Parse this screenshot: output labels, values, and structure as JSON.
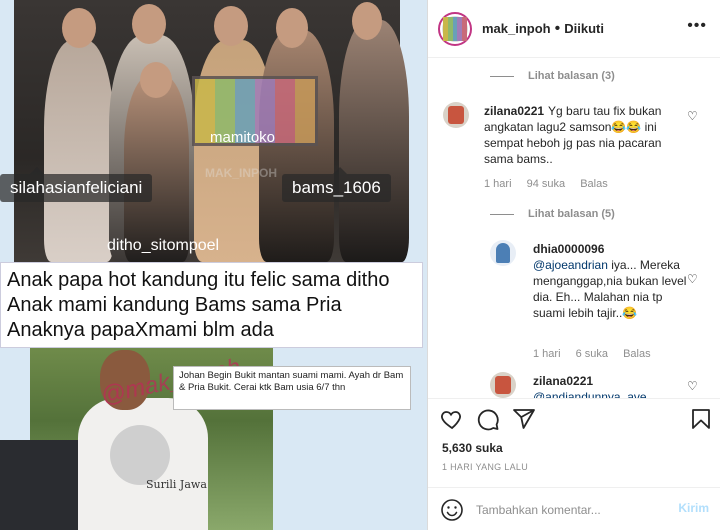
{
  "post": {
    "tags": [
      "mamitoko",
      "silahasianfeliciani",
      "bams_1606",
      "ditho_sitompoel"
    ],
    "watermark": "MAK_INPOH",
    "caption_lines": [
      "Anak papa hot kandung itu felic sama ditho",
      "Anak mami kandung Bams sama Pria",
      "Anaknya papaXmami blm ada"
    ],
    "lower_watermark": "@mak_inpoh",
    "note": "Johan Begin Bukit mantan suami mami. Ayah dr Bam & Pria Bukit. Cerai ktk Bam usia 6/7 thn",
    "shirt_text": "Surili Jawa"
  },
  "header": {
    "username": "mak_inpoh",
    "separator": "•",
    "following": "Diikuti",
    "more_icon": "more-horizontal-icon"
  },
  "comments": {
    "view_replies_1": "Lihat balasan (3)",
    "c1": {
      "username": "zilana0221",
      "text": "Yg baru tau fix bukan angkatan lagu2 samson😂😂 ini sempat heboh jg pas nia pacaran sama bams..",
      "time": "1 hari",
      "likes": "94 suka",
      "reply": "Balas"
    },
    "view_replies_2": "Lihat balasan (5)",
    "c2": {
      "username": "dhia0000096",
      "mention": "@ajoeandrian",
      "text": "iya... Mereka menganggap,nia bukan level dia. Eh... Malahan nia tp suami lebih tajir..😂",
      "time": "1 hari",
      "likes": "6 suka",
      "reply": "Balas"
    },
    "c3": {
      "username": "zilana0221",
      "mention": "@andiandunnya_ave"
    }
  },
  "actions": {
    "likes": "5,630 suka",
    "date": "1 HARI YANG LALU",
    "add_comment_placeholder": "Tambahkan komentar...",
    "post_label": "Kirim"
  },
  "colors": {
    "link": "#00376b",
    "muted": "#8e8e8e",
    "post_button_disabled": "#b2dffc",
    "tv_bars": [
      "#c9b74a",
      "#8fb96a",
      "#69a0b8",
      "#a07cb8",
      "#c86a7a",
      "#c89a5a"
    ]
  }
}
